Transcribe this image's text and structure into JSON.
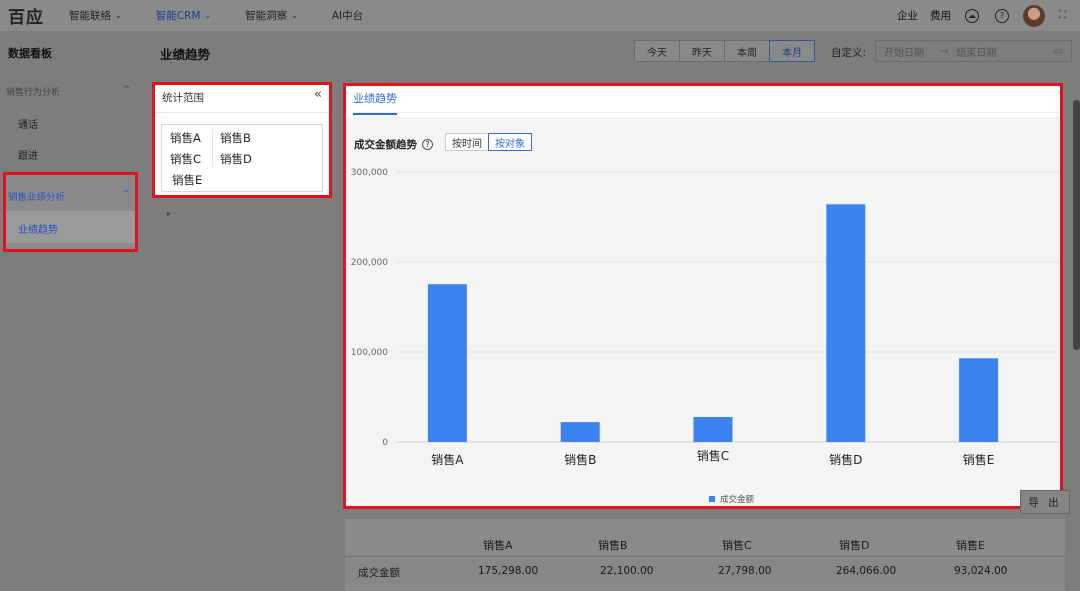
{
  "app": {
    "logo_text": "百应",
    "nav": [
      {
        "label": "智能联络",
        "has_caret": true,
        "active": false
      },
      {
        "label": "智能CRM",
        "has_caret": true,
        "active": true
      },
      {
        "label": "智能洞察",
        "has_caret": true,
        "active": false
      },
      {
        "label": "AI中台",
        "has_caret": false,
        "active": false
      }
    ],
    "top_right": {
      "enterprise_label": "企业",
      "cost_label": "费用",
      "icons": [
        "cloud-icon",
        "help-icon",
        "avatar",
        "expand-icon"
      ]
    }
  },
  "sidebar": {
    "title": "数据看板",
    "groups": [
      {
        "label": "销售行为分析",
        "items": [
          "通话",
          "跟进"
        ]
      },
      {
        "label": "销售业绩分析",
        "items": [
          "业绩趋势"
        ],
        "highlighted": true
      }
    ],
    "active_item": "业绩趋势"
  },
  "header": {
    "page_title": "业绩趋势",
    "date_buttons": [
      "今天",
      "昨天",
      "本周",
      "本月"
    ],
    "active_date_button": "本月",
    "custom_label": "自定义:",
    "start_placeholder": "开始日期",
    "range_separator": "→",
    "end_placeholder": "结束日期"
  },
  "scope_panel": {
    "title": "统计范围",
    "items": [
      "销售A",
      "销售B",
      "销售C",
      "销售D",
      "销售E"
    ],
    "dots": "▸ ·"
  },
  "chart_panel": {
    "tab_label": "业绩趋势",
    "chart_title": "成交金额趋势",
    "toggle": [
      "按时间",
      "按对象"
    ],
    "active_toggle": "按对象"
  },
  "chart_data": {
    "type": "bar",
    "categories": [
      "销售A",
      "销售B",
      "销售C",
      "销售D",
      "销售E"
    ],
    "series": [
      {
        "name": "成交金额",
        "values": [
          175298,
          22100,
          27798,
          264066,
          93024
        ],
        "color": "#3b82f0"
      }
    ],
    "ylim": [
      0,
      300000
    ],
    "yticks": [
      0,
      100000,
      200000,
      300000
    ],
    "ytick_labels": [
      "0",
      "100,000",
      "200,000",
      "300,000"
    ],
    "grid": true,
    "legend": "bottom-center"
  },
  "table": {
    "export_label": "导 出",
    "columns": [
      "",
      "销售A",
      "销售B",
      "销售C",
      "销售D",
      "销售E"
    ],
    "rows": [
      {
        "label": "成交金额",
        "values": [
          "175,298.00",
          "22,100.00",
          "27,798.00",
          "264,066.00",
          "93,024.00"
        ]
      }
    ]
  }
}
